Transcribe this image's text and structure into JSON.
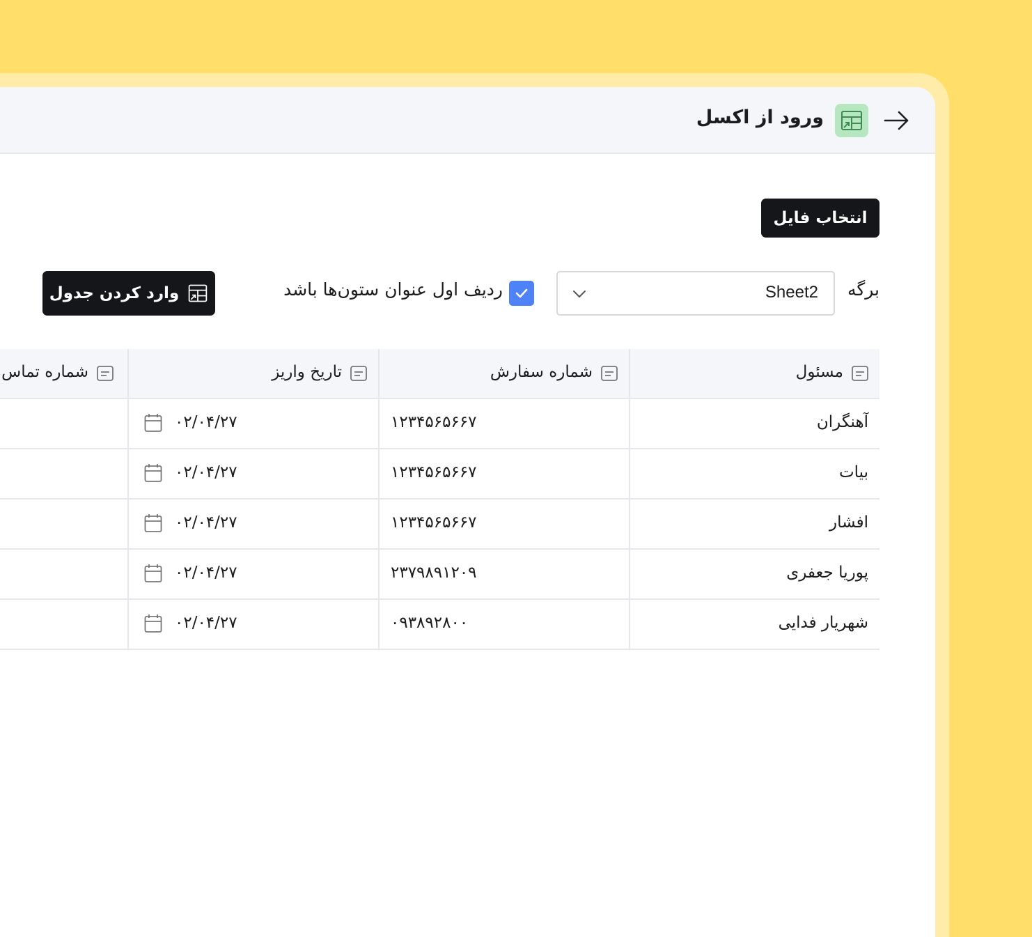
{
  "header": {
    "title": "ورود از اکسل"
  },
  "toolbar": {
    "choose_file_label": "انتخاب فایل",
    "sheet_label": "برگه",
    "sheet_selected": "Sheet2",
    "first_row_header_label": "ردیف اول عنوان ستون‌ها باشد",
    "first_row_header_checked": true,
    "import_table_label": "وارد کردن جدول"
  },
  "table": {
    "columns": [
      "مسئول",
      "شماره سفارش",
      "تاریخ واریز",
      "شماره تماس"
    ],
    "rows": [
      {
        "owner": "آهنگران",
        "order": "۱۲۳۴۵۶۵۶۶۷",
        "date": "۰۲/۰۴/۲۷"
      },
      {
        "owner": "بیات",
        "order": "۱۲۳۴۵۶۵۶۶۷",
        "date": "۰۲/۰۴/۲۷"
      },
      {
        "owner": "افشار",
        "order": "۱۲۳۴۵۶۵۶۶۷",
        "date": "۰۲/۰۴/۲۷"
      },
      {
        "owner": "پوریا جعفری",
        "order": "۲۳۷۹۸۹۱۲۰۹",
        "date": "۰۲/۰۴/۲۷"
      },
      {
        "owner": "شهریار فدایی",
        "order": "۰۹۳۸۹۲۸۰۰",
        "date": "۰۲/۰۴/۲۷"
      }
    ]
  },
  "colors": {
    "background": "#FFDE6A",
    "frame": "#FFECA8",
    "accent_checkbox": "#4F82F7",
    "excel_badge": "#B6E7C0",
    "button_dark": "#14161A"
  }
}
